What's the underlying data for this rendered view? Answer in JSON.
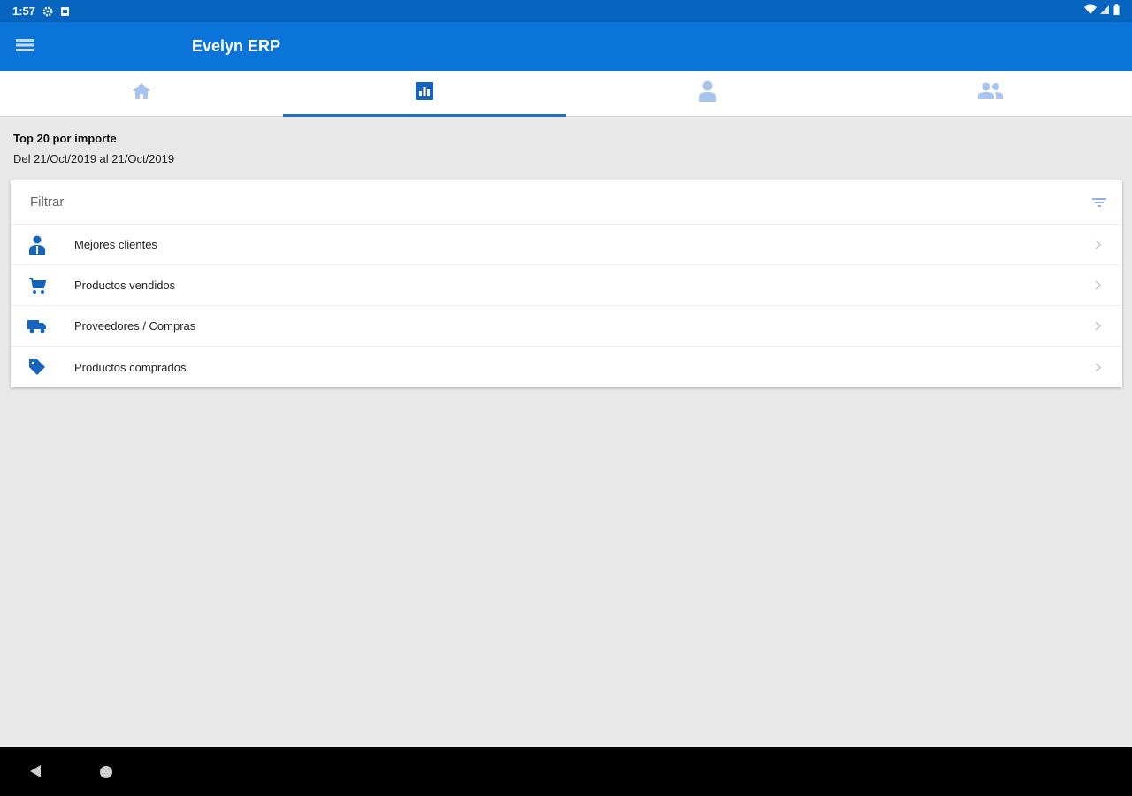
{
  "status_bar": {
    "time": "1:57",
    "icons": [
      "gear-icon",
      "sim-icon",
      "wifi-icon",
      "signal-icon",
      "battery-icon"
    ]
  },
  "app_bar": {
    "title": "Evelyn ERP",
    "menu_icon": "hamburger-menu-icon"
  },
  "tabs": [
    {
      "icon": "home-icon",
      "active": false
    },
    {
      "icon": "bar-chart-icon",
      "active": true
    },
    {
      "icon": "person-icon",
      "active": false
    },
    {
      "icon": "people-icon",
      "active": false
    }
  ],
  "report": {
    "title": "Top 20 por importe",
    "range": "Del 21/Oct/2019 al 21/Oct/2019"
  },
  "filter": {
    "label": "Filtrar",
    "icon": "filter-icon"
  },
  "items": [
    {
      "label": "Mejores clientes",
      "icon": "client-icon"
    },
    {
      "label": "Productos vendidos",
      "icon": "cart-icon"
    },
    {
      "label": "Proveedores / Compras",
      "icon": "truck-icon"
    },
    {
      "label": "Productos comprados",
      "icon": "tag-icon"
    }
  ],
  "colors": {
    "status_bar": "#0764bf",
    "app_bar": "#0a74d9",
    "accent": "#1f6fd0",
    "inactive_tab_icon": "#a9c3f0",
    "background": "#e8e8e8"
  },
  "nav_bar": {
    "icons": [
      "back-icon",
      "home-circle-icon"
    ]
  }
}
